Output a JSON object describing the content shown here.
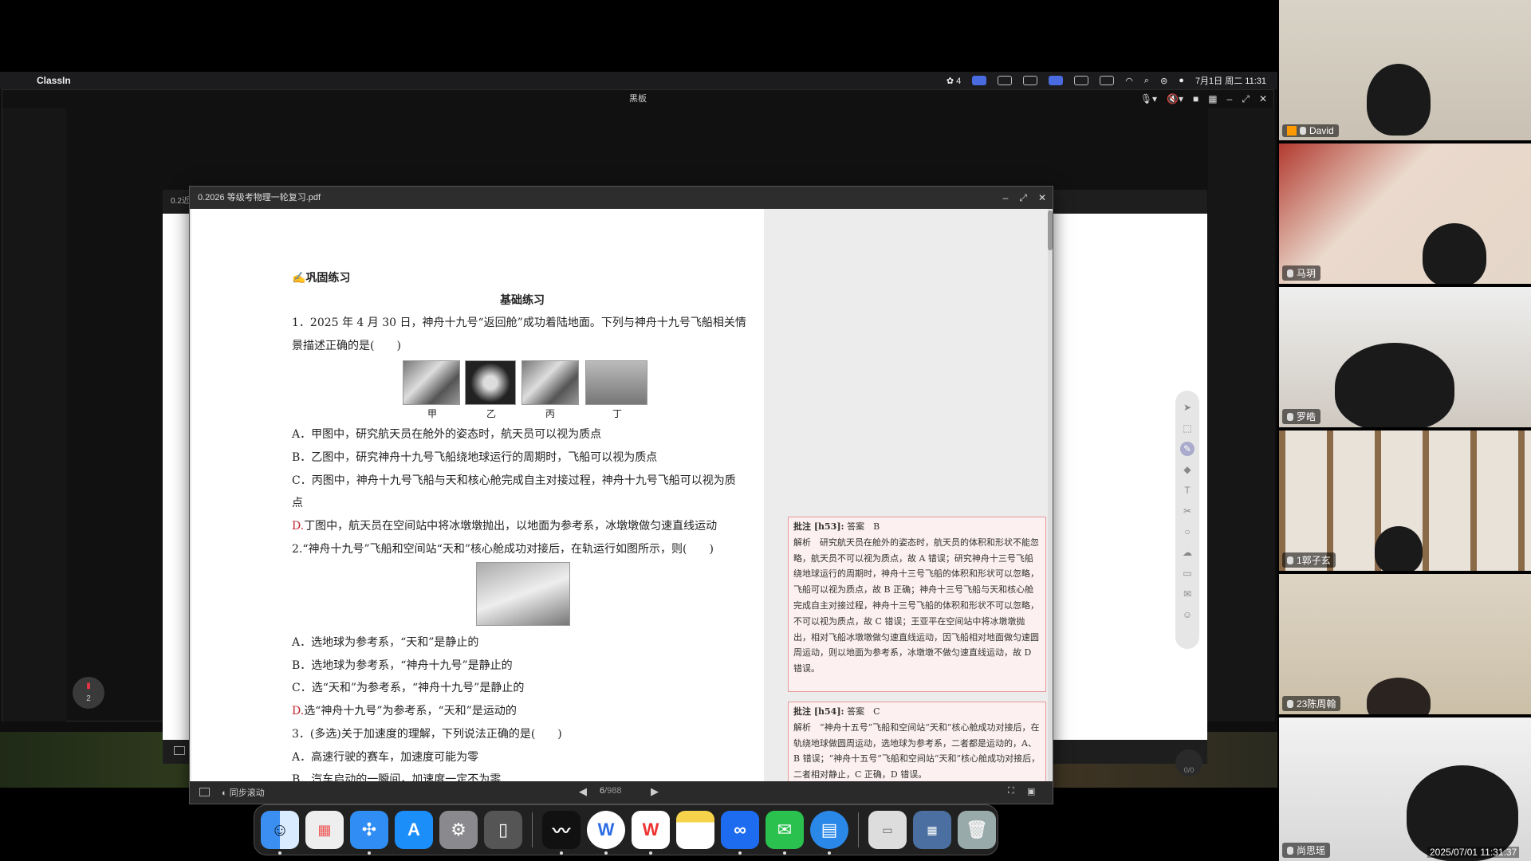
{
  "menubar": {
    "app_name": "ClassIn",
    "wechat_count": "4",
    "datetime": "7月1日 周二 11:31"
  },
  "classin": {
    "window_title": "黑板",
    "board_tab": "0.2近",
    "pdf_badge": "2",
    "counter": "0/0"
  },
  "pdf": {
    "title": "0.2026 等级考物理一轮复习.pdf",
    "sync_scroll": "同步滚动",
    "page_current": "6",
    "page_total": "/988",
    "section": "巩固练习",
    "subsection": "基础练习",
    "q1_line1": "1．2025 年 4 月 30 日，神舟十九号“返回舱”成功着陆地面。下列与神舟十九号飞船相关情",
    "q1_line2": "景描述正确的是(　　)",
    "captions": [
      "甲",
      "乙",
      "丙",
      "丁"
    ],
    "q1_A": "A．甲图中，研究航天员在舱外的姿态时，航天员可以视为质点",
    "q1_B": "B．乙图中，研究神舟十九号飞船绕地球运行的周期时，飞船可以视为质点",
    "q1_C1": "C．丙图中，神舟十九号飞船与天和核心舱完成自主对接过程，神舟十九号飞船可以视为质",
    "q1_C2": "点",
    "q1_D_letter": "D.",
    "q1_D": "丁图中，航天员在空间站中将冰墩墩抛出，以地面为参考系，冰墩墩做匀速直线运动",
    "q2": "2.“神舟十九号”飞船和空间站“天和”核心舱成功对接后，在轨运行如图所示，则(　　)",
    "q2_A": "A．选地球为参考系，“天和”是静止的",
    "q2_B": "B．选地球为参考系，“神舟十九号”是静止的",
    "q2_C": "C．选“天和”为参考系，“神舟十九号”是静止的",
    "q2_D_letter": "D.",
    "q2_D": "选“神舟十九号”为参考系，“天和”是运动的",
    "q3": "3．(多选)关于加速度的理解，下列说法正确的是(　　)",
    "q3_A": "A．高速行驶的赛车，加速度可能为零",
    "q3_B": "B．汽车启动的一瞬间，加速度一定不为零",
    "note1_head": "批注 [h53]:",
    "note1_answer": "答案　B",
    "note1_body": "解析　研究航天员在舱外的姿态时，航天员的体积和形状不能忽略，航天员不可以视为质点，故 A 错误；研究神舟十三号飞船绕地球运行的周期时，神舟十三号飞船的体积和形状可以忽略，飞船可以视为质点，故 B 正确；神舟十三号飞船与天和核心舱完成自主对接过程，神舟十三号飞船的体积和形状不可以忽略，不可以视为质点，故 C 错误；王亚平在空间站中将冰墩墩抛出，相对飞船冰墩墩做匀速直线运动，因飞船相对地面做匀速圆周运动，则以地面为参考系，冰墩墩不做匀速直线运动，故 D 错误。",
    "note2_head": "批注 [h54]:",
    "note2_answer": "答案　C",
    "note2_body": "解析　“神舟十五号”飞船和空间站“天和”核心舱成功对接后，在轨绕地球做圆周运动，选地球为参考系，二者都是运动的，A、B 错误；“神舟十五号”飞船和空间站“天和”核心舱成功对接后，二者相对静止，C 正确，D 错误。"
  },
  "dock": {
    "apps": [
      "finder-icon",
      "launchpad-icon",
      "safari-icon",
      "appstore-icon",
      "settings-icon",
      "iphone-mirroring-icon",
      "feishu-icon",
      "wps-w-icon",
      "wps-office-icon",
      "notes-icon",
      "tencent-meeting-icon",
      "wechat-icon",
      "reader-icon",
      "document-icon",
      "screenshot-folder-icon",
      "trash-icon"
    ]
  },
  "participants": [
    {
      "name": "David"
    },
    {
      "name": "马玥"
    },
    {
      "name": "罗皓"
    },
    {
      "name": "1郭子玄"
    },
    {
      "name": "23陈周翰"
    },
    {
      "name": "尚思瑶"
    }
  ],
  "timestamp": "2025/07/01 11:31:37",
  "colors": {
    "accent_red": "#c0252f",
    "note_border": "#e89a9a"
  }
}
